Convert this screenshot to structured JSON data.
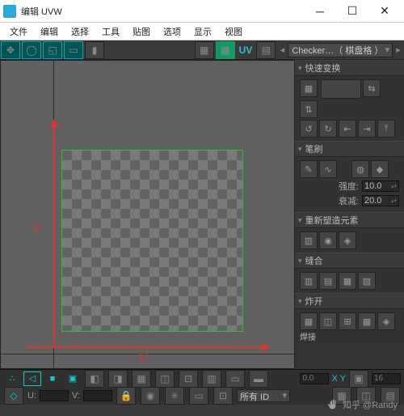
{
  "window": {
    "title": "编辑 UVW"
  },
  "menu": [
    "文件",
    "编辑",
    "选择",
    "工具",
    "贴图",
    "选项",
    "显示",
    "视图"
  ],
  "toolbar": {
    "uv_label": "UV",
    "checker_dropdown": "Checker…（ 棋盘格 ）"
  },
  "panel": {
    "quick_transform": {
      "title": "快速变换"
    },
    "brush": {
      "title": "笔刷",
      "strength_label": "强度:",
      "strength_value": "10.0",
      "falloff_label": "衰减:",
      "falloff_value": "20.0"
    },
    "reshape": {
      "title": "重新塑造元素"
    },
    "stitch": {
      "title": "缝合"
    },
    "explode": {
      "title": "炸开",
      "weld_label": "焊接"
    }
  },
  "selection": {
    "coord_value": "0.0",
    "xy_label": "X Y",
    "count_value": "16"
  },
  "status": {
    "u_label": "U:",
    "v_label": "V:",
    "id_label": "所有 ID"
  },
  "axes": {
    "u": "U",
    "v": "V"
  },
  "watermark": "知乎 @Randy"
}
